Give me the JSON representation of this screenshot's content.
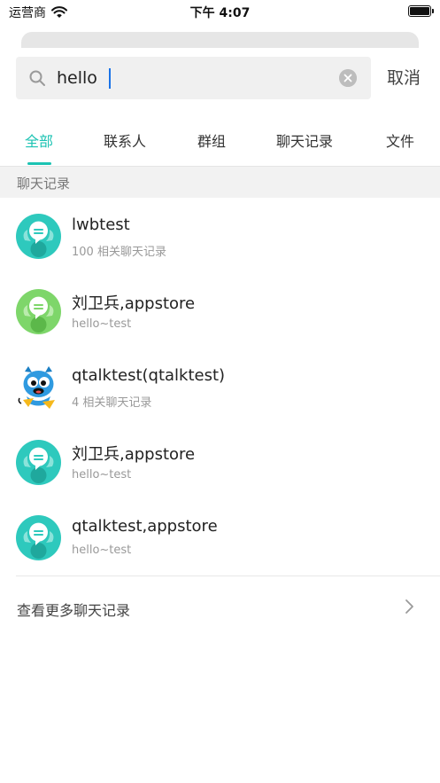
{
  "status_bar": {
    "carrier": "运营商",
    "time": "下午 4:07"
  },
  "search": {
    "value": "hello",
    "placeholder": "",
    "cancel_label": "取消"
  },
  "tabs": [
    {
      "label": "全部",
      "active": true
    },
    {
      "label": "联系人",
      "active": false
    },
    {
      "label": "群组",
      "active": false
    },
    {
      "label": "聊天记录",
      "active": false
    },
    {
      "label": "文件",
      "active": false
    }
  ],
  "section": {
    "title": "聊天记录"
  },
  "results": [
    {
      "title": "lwbtest",
      "subtitle": "100 相关聊天记录",
      "avatar": "group-avatar-teal-icon"
    },
    {
      "title": "刘卫兵,appstore",
      "subtitle": "hello~test",
      "avatar": "group-avatar-green-icon"
    },
    {
      "title": "qtalktest(qtalktest)",
      "subtitle": "4 相关聊天记录",
      "avatar": "mascot-avatar-icon"
    },
    {
      "title": "刘卫兵,appstore",
      "subtitle": "hello~test",
      "avatar": "group-avatar-teal-icon"
    },
    {
      "title": "qtalktest,appstore",
      "subtitle": "hello~test",
      "avatar": "group-avatar-teal-icon"
    }
  ],
  "more": {
    "label": "查看更多聊天记录"
  },
  "colors": {
    "accent": "#1cc3b3",
    "avatar_teal": "#2ec9bd",
    "avatar_green": "#7ed66a"
  }
}
